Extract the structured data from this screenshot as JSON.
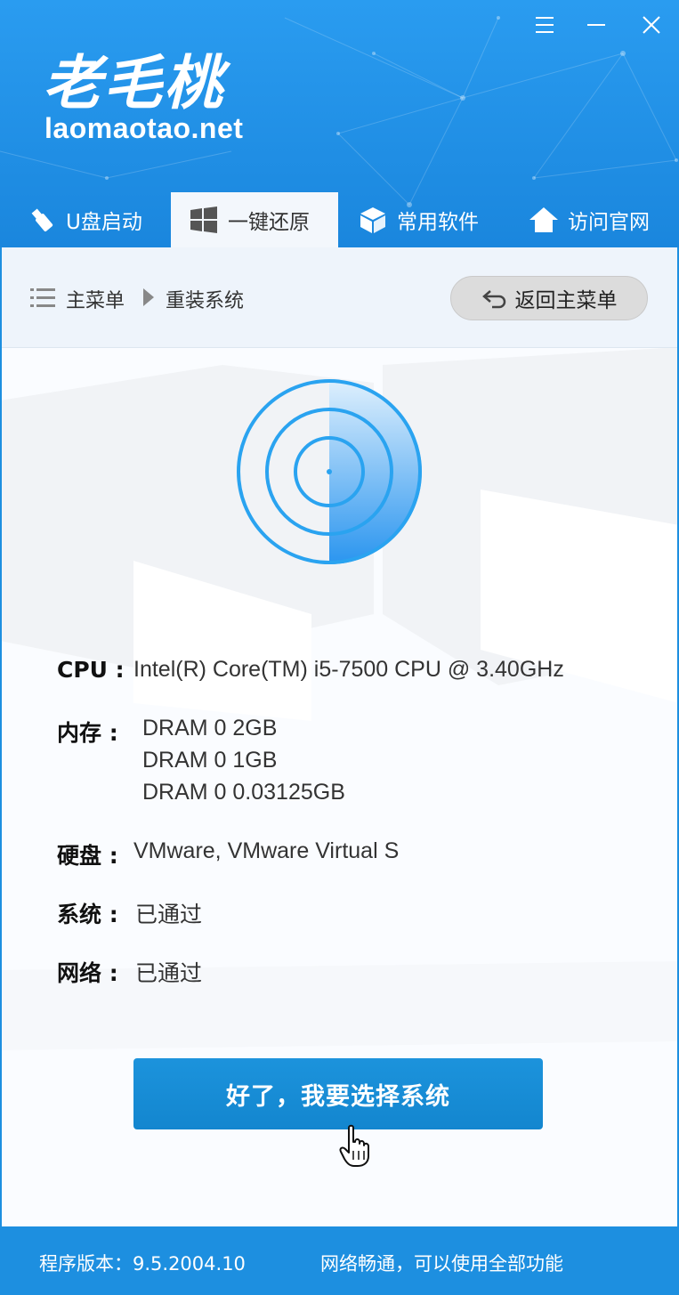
{
  "window": {
    "logo_cn": "老毛桃",
    "logo_url": "laomaotao.net",
    "menu_icon": "menu-icon",
    "minimize_icon": "minimize-icon",
    "close_icon": "close-icon"
  },
  "tabs": [
    {
      "label": "U盘启动",
      "icon": "usb-icon",
      "active": false
    },
    {
      "label": "一键还原",
      "icon": "windows-icon",
      "active": true
    },
    {
      "label": "常用软件",
      "icon": "box-icon",
      "active": false
    },
    {
      "label": "访问官网",
      "icon": "home-icon",
      "active": false
    }
  ],
  "breadcrumb": {
    "root": "主菜单",
    "current": "重装系统",
    "back_label": "返回主菜单"
  },
  "info": {
    "cpu_label": "CPU :",
    "cpu_value": "Intel(R) Core(TM) i5-7500 CPU @ 3.40GHz",
    "mem_label": "内存 :",
    "mem_values": [
      "DRAM 0 2GB",
      "DRAM 0 1GB",
      "DRAM 0 0.03125GB"
    ],
    "disk_label": "硬盘 :",
    "disk_value": "VMware, VMware Virtual S",
    "sys_label": "系统 :",
    "sys_value": "已通过",
    "net_label": "网络 :",
    "net_value": "已通过"
  },
  "action": {
    "confirm_label": "好了，我要选择系统"
  },
  "footer": {
    "version": "程序版本：9.5.2004.10",
    "status": "网络畅通，可以使用全部功能"
  },
  "colors": {
    "brand_blue": "#1d8fe0",
    "radar_blue": "#2aa3f0",
    "button_blue": "#1589d2"
  }
}
